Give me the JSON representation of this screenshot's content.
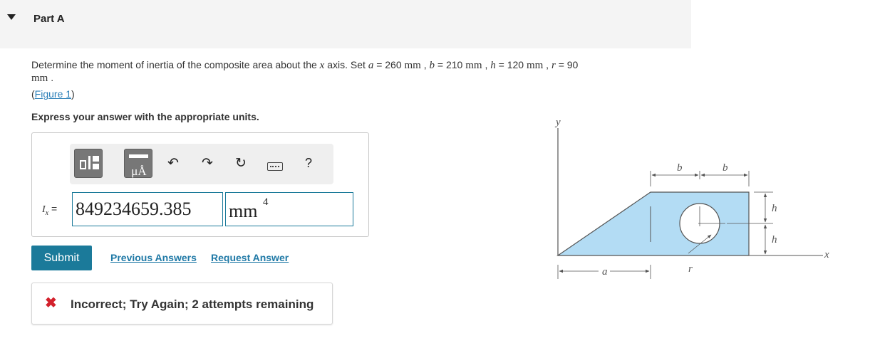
{
  "part": {
    "title": "Part A"
  },
  "problem": {
    "t1": "Determine the moment of inertia of the composite area about the ",
    "x": "x",
    "t2": " axis. Set ",
    "a": "a",
    "a_val": " = 260 ",
    "mm": "mm",
    "sep": " , ",
    "b": "b",
    "b_val": " = 210 ",
    "h": "h",
    "h_val": " = 120 ",
    "r": "r",
    "r_val": " = 90",
    "end": " ."
  },
  "figure_link": {
    "open": "(",
    "label": "Figure 1",
    "close": ")"
  },
  "instructions": "Express your answer with the appropriate units.",
  "toolbar": {
    "templates_icon": "templates-icon",
    "units_icon": "units-icon",
    "units_label": "μÅ",
    "undo": "↶",
    "redo": "↷",
    "reset": "↻",
    "keyboard_icon": "keyboard-icon",
    "help": "?"
  },
  "answer": {
    "label_I": "I",
    "label_sub": "x",
    "label_eq": " =",
    "value": "849234659.385",
    "units": "mm",
    "units_exp": "4"
  },
  "actions": {
    "submit": "Submit",
    "previous": "Previous Answers",
    "request": "Request Answer"
  },
  "feedback": {
    "icon": "✖",
    "text": "Incorrect; Try Again; 2 attempts remaining"
  },
  "figure": {
    "y_axis": "y",
    "x_axis": "x",
    "a": "a",
    "b1": "b",
    "b2": "b",
    "h1": "h",
    "h2": "h",
    "r": "r",
    "fill_color": "#b3dcf4"
  },
  "colors": {
    "accent": "#1b7a9a",
    "link": "#1f79a6",
    "error": "#d3212c",
    "header_bg": "#f4f4f4"
  }
}
